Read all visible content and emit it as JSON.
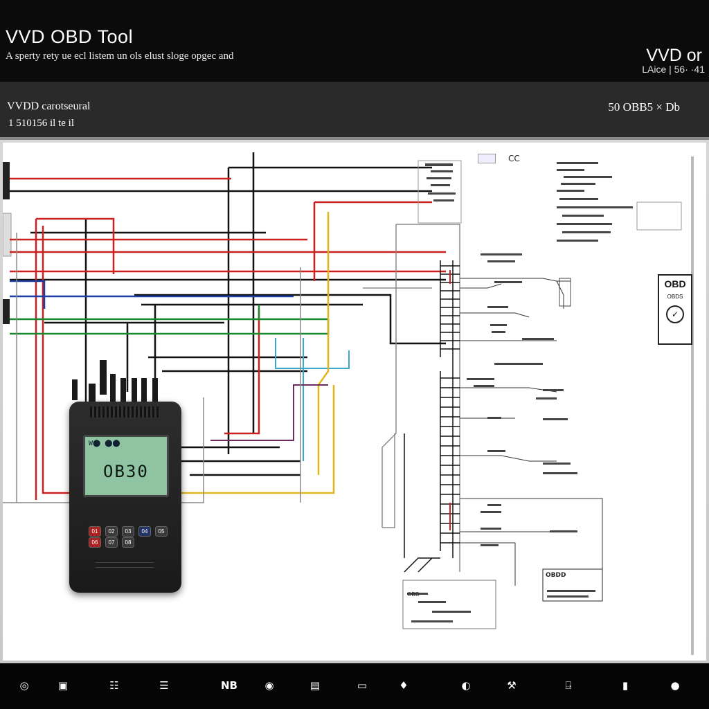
{
  "header": {
    "title": "VVD OBD Tool",
    "subtitle": "A sperty rety ue ecl listem un ols elust sloge opgec and",
    "brand": "VVD or",
    "brand_code": "LAice | 56· ·41"
  },
  "subheader": {
    "title": "VVDD carotseural",
    "count": "1 510156 il te il",
    "right_label": "50 OBB5 × Db"
  },
  "device": {
    "screen_top": "W⬤ ⬤⬤",
    "screen_value": "OB30",
    "keys": [
      "01",
      "02",
      "03",
      "04",
      "05",
      "06",
      "07",
      "08"
    ]
  },
  "panels": {
    "top_icons": "CC",
    "obd_logo": "OBD",
    "obd_sub": "OBDS",
    "obd_seal": "✓",
    "box1": "OBDD",
    "box2": "OBD"
  },
  "toolbar": [
    {
      "icon": "monitor-icon",
      "glyph": "◎",
      "label": ""
    },
    {
      "icon": "scanner-icon",
      "glyph": "▣",
      "label": ""
    },
    {
      "icon": "settings-icon",
      "glyph": "☷",
      "label": ""
    },
    {
      "icon": "device-icon",
      "glyph": "☰",
      "label": ""
    },
    {
      "icon": "nb-icon",
      "glyph": "NB",
      "label": ""
    },
    {
      "icon": "car-icon",
      "glyph": "◉",
      "label": ""
    },
    {
      "icon": "photo-icon",
      "glyph": "▤",
      "label": ""
    },
    {
      "icon": "link-icon",
      "glyph": "▭",
      "label": ""
    },
    {
      "icon": "engine-icon",
      "glyph": "♦",
      "label": ""
    },
    {
      "icon": "gauge-icon",
      "glyph": "◐",
      "label": ""
    },
    {
      "icon": "tools-icon",
      "glyph": "⚒",
      "label": ""
    },
    {
      "icon": "chart-icon",
      "glyph": "⍈",
      "label": ""
    },
    {
      "icon": "battery-icon",
      "glyph": "▮",
      "label": ""
    },
    {
      "icon": "help-icon",
      "glyph": "●",
      "label": ""
    }
  ],
  "colors": {
    "wire_red": "#cc1f1f",
    "wire_black": "#111111",
    "wire_green": "#1a8a2e",
    "wire_blue": "#1f3fa8",
    "wire_cyan": "#3aa9cf",
    "wire_yellow": "#e0b51c",
    "wire_purple": "#6b2b5e",
    "wire_gray": "#8a8a8a"
  }
}
